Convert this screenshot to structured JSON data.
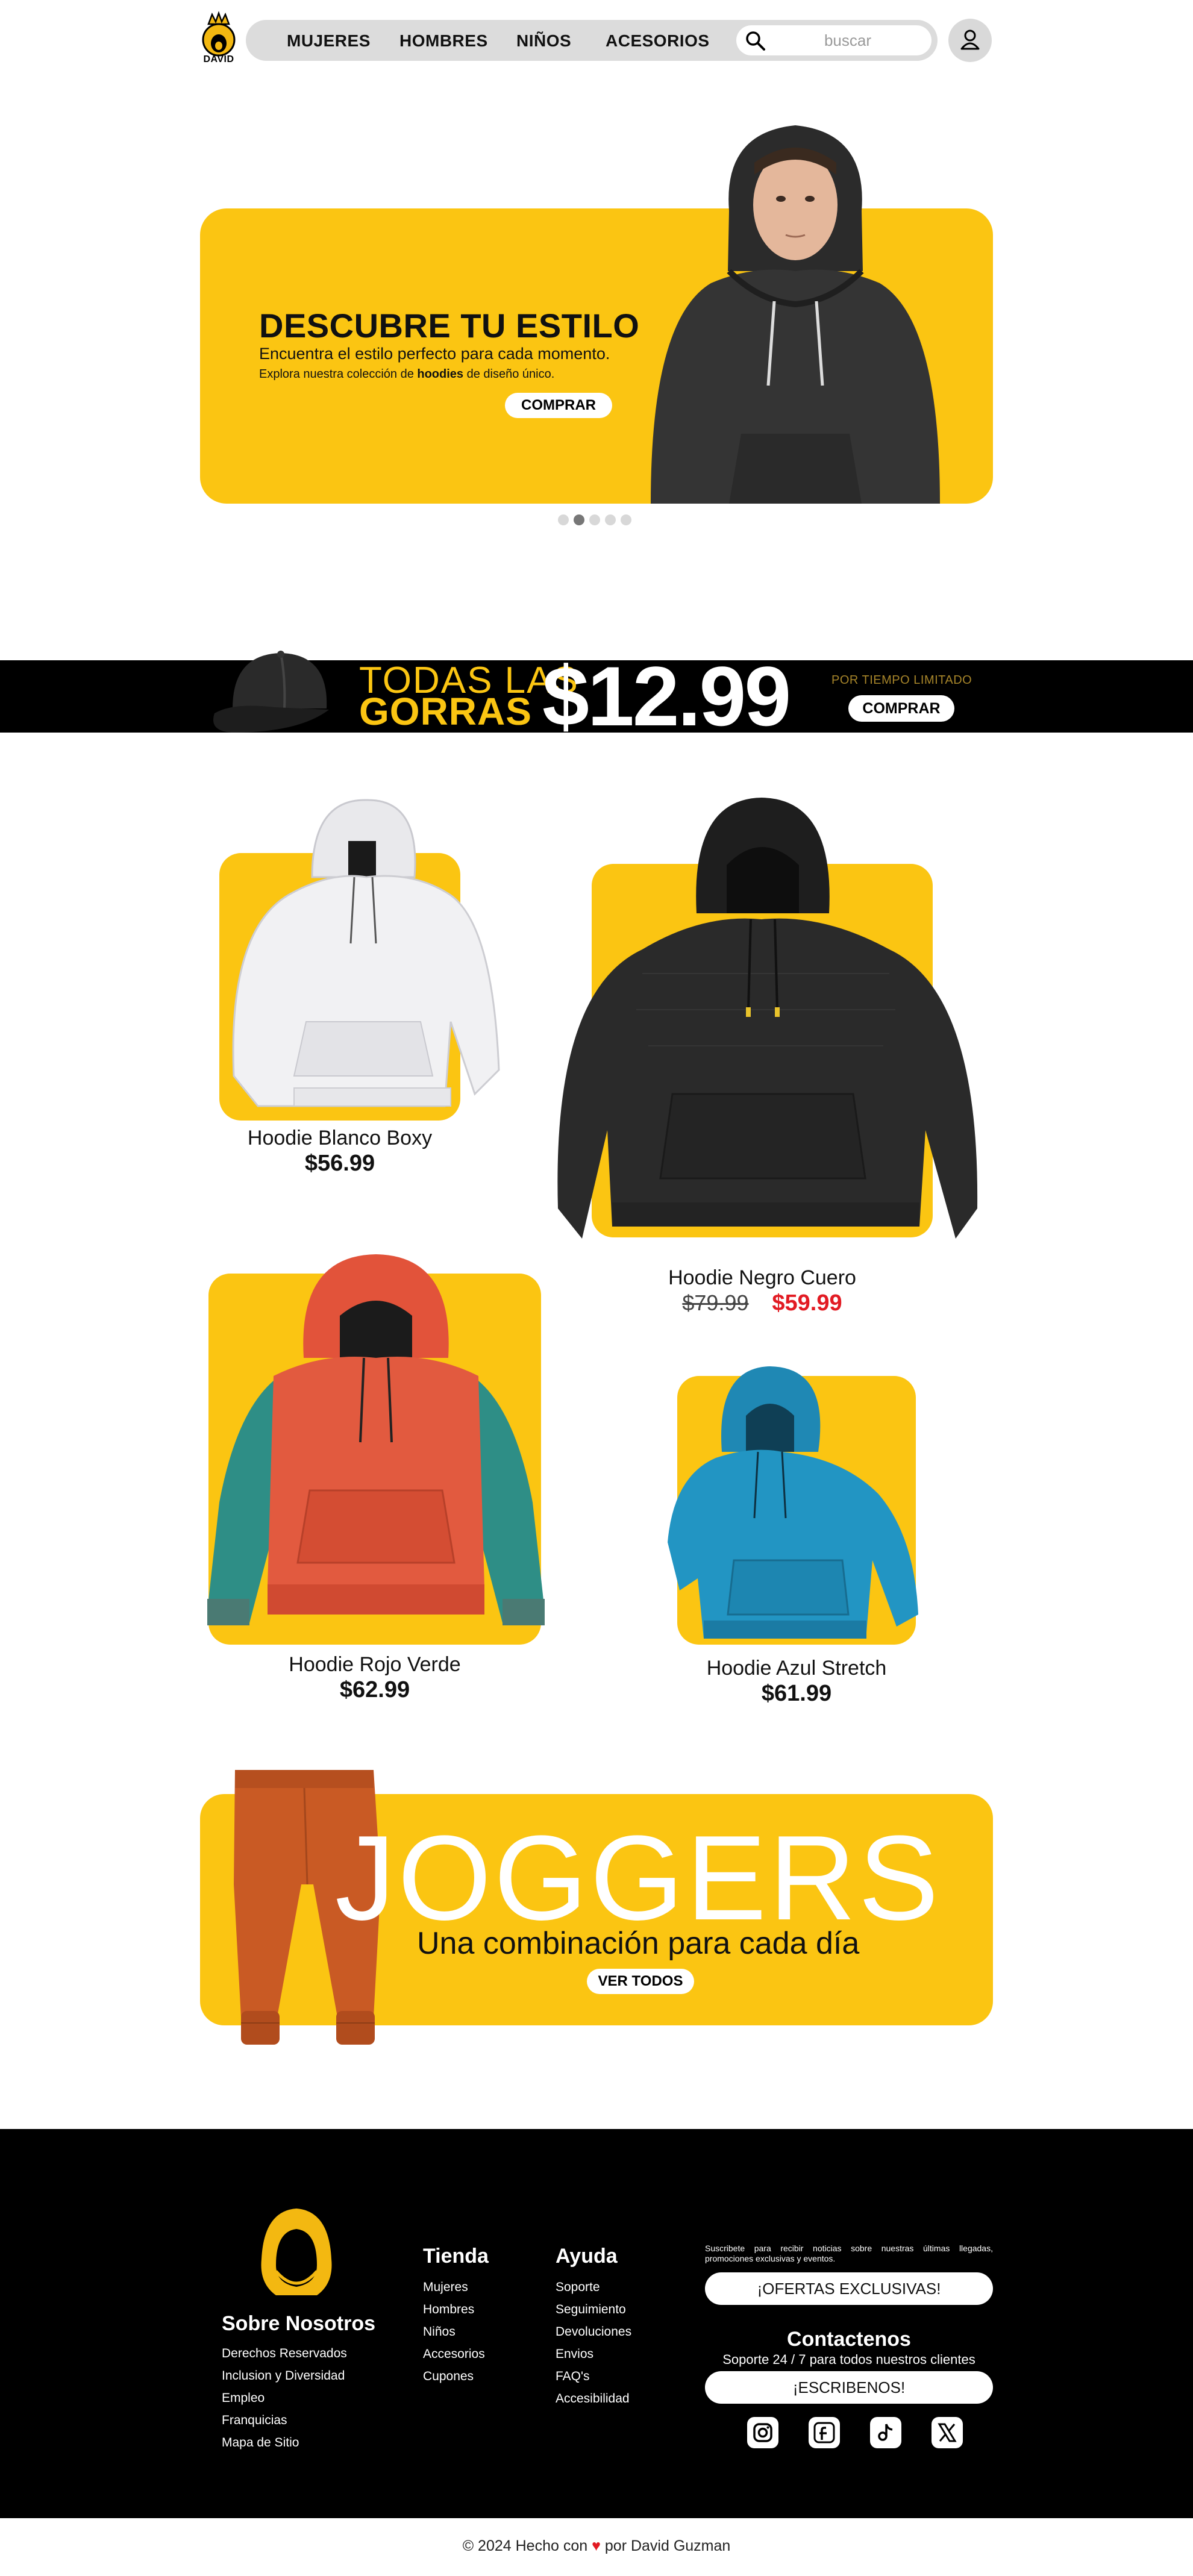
{
  "brand": {
    "logo_text": "DAVID"
  },
  "nav": {
    "links": [
      "MUJERES",
      "HOMBRES",
      "NIÑOS",
      "ACESORIOS"
    ],
    "search_placeholder": "buscar"
  },
  "hero": {
    "title": "DESCUBRE TU ESTILO",
    "subtitle": "Encuentra el estilo perfecto para cada momento.",
    "small_pre": "Explora nuestra colección de ",
    "small_bold": "hoodies",
    "small_post": " de diseño único.",
    "button": "COMPRAR",
    "slides_count": 5,
    "active_slide": 2
  },
  "promo": {
    "line1": "TODAS LAS",
    "line2": "GORRAS",
    "price": "$12.99",
    "limited": "POR TIEMPO LIMITADO",
    "button": "COMPRAR"
  },
  "products": [
    {
      "name": "Hoodie Blanco Boxy",
      "price": "$56.99"
    },
    {
      "name": "Hoodie Negro Cuero",
      "old_price": "$79.99",
      "price": "$59.99"
    },
    {
      "name": "Hoodie Rojo Verde",
      "price": "$62.99"
    },
    {
      "name": "Hoodie Azul Stretch",
      "price": "$61.99"
    }
  ],
  "joggers": {
    "title": "JOGGERS",
    "subtitle": "Una combinación para cada día",
    "button": "VER TODOS"
  },
  "footer": {
    "about": {
      "title": "Sobre Nosotros",
      "links": [
        "Derechos Reservados",
        "Inclusion y Diversidad",
        "Empleo",
        "Franquicias",
        "Mapa de Sitio"
      ]
    },
    "tienda": {
      "title": "Tienda",
      "links": [
        "Mujeres",
        "Hombres",
        "Niños",
        "Accesorios",
        "Cupones"
      ]
    },
    "ayuda": {
      "title": "Ayuda",
      "links": [
        "Soporte",
        "Seguimiento",
        "Devoluciones",
        "Envios",
        "FAQ's",
        "Accesibilidad"
      ]
    },
    "newsletter_text": "Suscribete para recibir noticias sobre nuestras últimas llegadas, promociones exclusivas y eventos.",
    "offers_button": "¡OFERTAS EXCLUSIVAS!",
    "contact_title": "Contactenos",
    "contact_sub": "Soporte 24 / 7 para todos nuestros clientes",
    "contact_button": "¡ESCRIBENOS!",
    "socials": [
      "instagram-icon",
      "facebook-icon",
      "tiktok-icon",
      "x-icon"
    ],
    "copyright_pre": "© 2024 Hecho con ",
    "copyright_post": " por David Guzman"
  },
  "colors": {
    "accent": "#fbc512",
    "sale": "#e21b23",
    "dark": "#000000"
  }
}
